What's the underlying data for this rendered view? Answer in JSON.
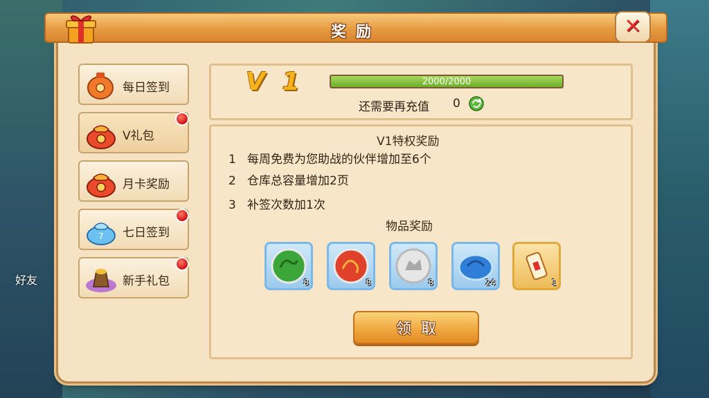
{
  "dialog": {
    "title": "奖励"
  },
  "sidebar": {
    "items": [
      {
        "label": "每日签到",
        "badge": false
      },
      {
        "label": "V礼包",
        "badge": true
      },
      {
        "label": "月卡奖励",
        "badge": false
      },
      {
        "label": "七日签到",
        "badge": true
      },
      {
        "label": "新手礼包",
        "badge": true
      }
    ]
  },
  "vip": {
    "level": "V 1",
    "progress_text": "2000/2000",
    "progress_fraction": 1.0,
    "recharge_label": "还需要再充值",
    "recharge_value": "0"
  },
  "perks": {
    "title": "V1特权奖励",
    "items": [
      {
        "num": "1",
        "text": "每周免费为您助战的伙伴增加至6个"
      },
      {
        "num": "2",
        "text": "仓库总容量增加2页"
      },
      {
        "num": "3",
        "text": "补签次数加1次"
      }
    ]
  },
  "rewards": {
    "title": "物品奖励",
    "items": [
      {
        "icon": "green-jade-icon",
        "count": "8"
      },
      {
        "icon": "red-jade-icon",
        "count": "8"
      },
      {
        "icon": "silver-tiger-jade-icon",
        "count": "8"
      },
      {
        "icon": "blue-turtle-jade-icon",
        "count": "24"
      },
      {
        "icon": "scroll-icon",
        "count": "1"
      }
    ]
  },
  "claim_button": {
    "label": "领取"
  },
  "background": {
    "friend_label": "好友"
  },
  "colors": {
    "accent": "#e79b43",
    "badge": "#d10f12",
    "progress": "#6cae2b"
  }
}
